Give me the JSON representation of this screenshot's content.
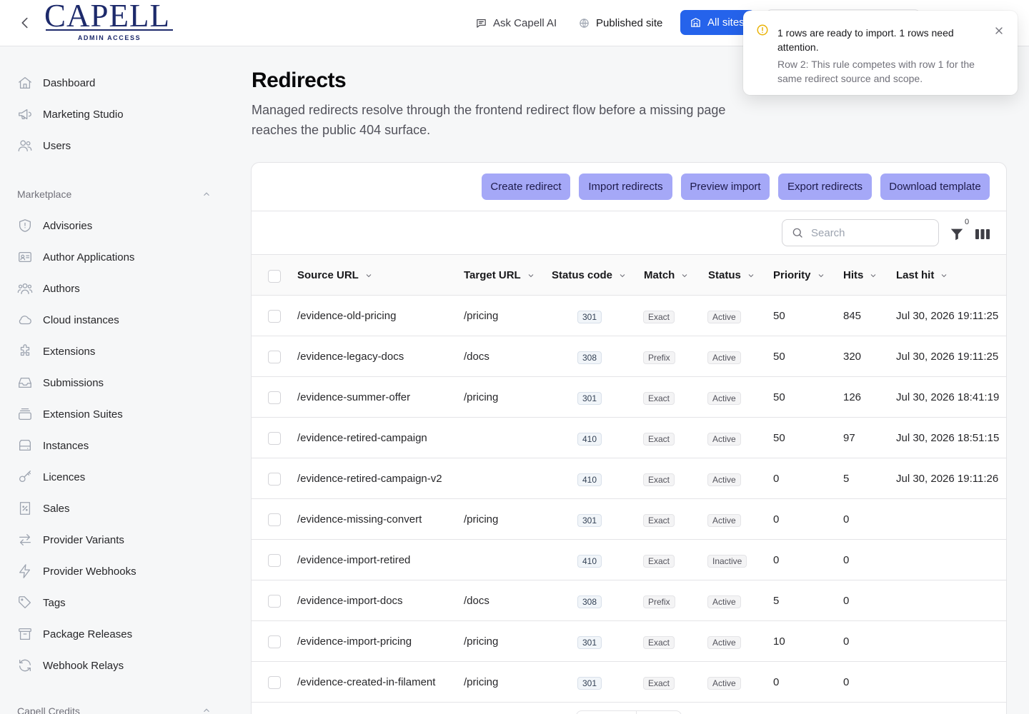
{
  "logo": {
    "word": "CAPELL",
    "subtitle": "ADMIN ACCESS"
  },
  "topbar": {
    "ask_ai": "Ask Capell AI",
    "published_site": "Published site",
    "all_sites": "All sites"
  },
  "sidebar": {
    "top_items": [
      {
        "label": "Dashboard",
        "icon": "home-icon"
      },
      {
        "label": "Marketing Studio",
        "icon": "megaphone-icon"
      },
      {
        "label": "Users",
        "icon": "users-icon"
      }
    ],
    "group_label": "Marketplace",
    "group_items": [
      {
        "label": "Advisories",
        "icon": "shield-icon"
      },
      {
        "label": "Author Applications",
        "icon": "id-card-icon"
      },
      {
        "label": "Authors",
        "icon": "user-group-icon"
      },
      {
        "label": "Cloud instances",
        "icon": "cloud-icon"
      },
      {
        "label": "Extensions",
        "icon": "puzzle-icon"
      },
      {
        "label": "Submissions",
        "icon": "inbox-icon"
      },
      {
        "label": "Extension Suites",
        "icon": "stack-icon"
      },
      {
        "label": "Instances",
        "icon": "server-icon"
      },
      {
        "label": "Licences",
        "icon": "key-icon"
      },
      {
        "label": "Sales",
        "icon": "receipt-icon"
      },
      {
        "label": "Provider Variants",
        "icon": "arrows-icon"
      },
      {
        "label": "Provider Webhooks",
        "icon": "bolt-icon"
      },
      {
        "label": "Tags",
        "icon": "tag-icon"
      },
      {
        "label": "Package Releases",
        "icon": "archive-icon"
      },
      {
        "label": "Webhook Relays",
        "icon": "refresh-icon"
      }
    ],
    "bottom_group_label": "Capell Credits"
  },
  "page": {
    "title": "Redirects",
    "description": "Managed redirects resolve through the frontend redirect flow before a missing page reaches the public 404 surface."
  },
  "actions": {
    "create": "Create redirect",
    "import": "Import redirects",
    "preview": "Preview import",
    "export": "Export redirects",
    "template": "Download template"
  },
  "toolbar": {
    "search_placeholder": "Search",
    "filter_count": "0"
  },
  "table": {
    "columns": [
      "Source URL",
      "Target URL",
      "Status code",
      "Match",
      "Status",
      "Priority",
      "Hits",
      "Last hit"
    ],
    "rows": [
      {
        "source": "/evidence-old-pricing",
        "target": "/pricing",
        "code": "301",
        "match": "Exact",
        "status": "Active",
        "priority": "50",
        "hits": "845",
        "last_hit": "Jul 30, 2026 19:11:25"
      },
      {
        "source": "/evidence-legacy-docs",
        "target": "/docs",
        "code": "308",
        "match": "Prefix",
        "status": "Active",
        "priority": "50",
        "hits": "320",
        "last_hit": "Jul 30, 2026 19:11:25"
      },
      {
        "source": "/evidence-summer-offer",
        "target": "/pricing",
        "code": "301",
        "match": "Exact",
        "status": "Active",
        "priority": "50",
        "hits": "126",
        "last_hit": "Jul 30, 2026 18:41:19"
      },
      {
        "source": "/evidence-retired-campaign",
        "target": "",
        "code": "410",
        "match": "Exact",
        "status": "Active",
        "priority": "50",
        "hits": "97",
        "last_hit": "Jul 30, 2026 18:51:15"
      },
      {
        "source": "/evidence-retired-campaign-v2",
        "target": "",
        "code": "410",
        "match": "Exact",
        "status": "Active",
        "priority": "0",
        "hits": "5",
        "last_hit": "Jul 30, 2026 19:11:26"
      },
      {
        "source": "/evidence-missing-convert",
        "target": "/pricing",
        "code": "301",
        "match": "Exact",
        "status": "Active",
        "priority": "0",
        "hits": "0",
        "last_hit": ""
      },
      {
        "source": "/evidence-import-retired",
        "target": "",
        "code": "410",
        "match": "Exact",
        "status": "Inactive",
        "priority": "0",
        "hits": "0",
        "last_hit": ""
      },
      {
        "source": "/evidence-import-docs",
        "target": "/docs",
        "code": "308",
        "match": "Prefix",
        "status": "Active",
        "priority": "5",
        "hits": "0",
        "last_hit": ""
      },
      {
        "source": "/evidence-import-pricing",
        "target": "/pricing",
        "code": "301",
        "match": "Exact",
        "status": "Active",
        "priority": "10",
        "hits": "0",
        "last_hit": ""
      },
      {
        "source": "/evidence-created-in-filament",
        "target": "/pricing",
        "code": "301",
        "match": "Exact",
        "status": "Active",
        "priority": "0",
        "hits": "0",
        "last_hit": ""
      }
    ]
  },
  "toast": {
    "title": "1 rows are ready to import. 1 rows need attention.",
    "body": "Row 2: This rule competes with row 1 for the same redirect source and scope.",
    "icon": "warning-circle-icon"
  },
  "colors": {
    "accent": "#2563eb",
    "action_button": "#a5a8f7",
    "logo": "#1d2a6b",
    "warning": "#eab308"
  }
}
